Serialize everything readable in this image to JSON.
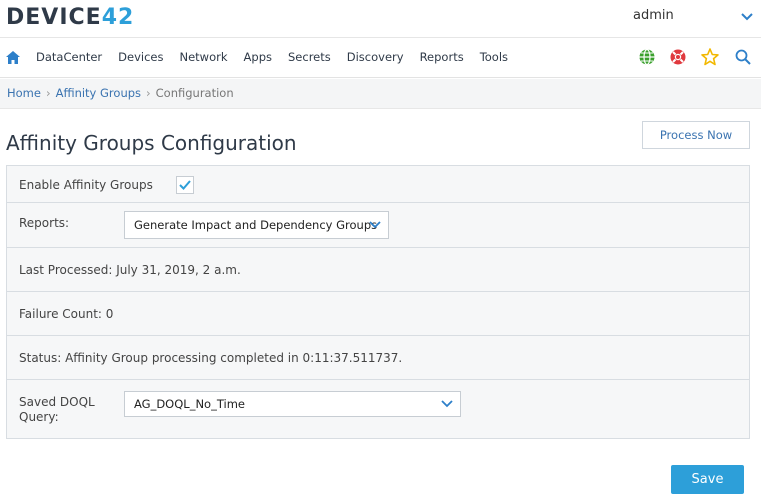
{
  "brand": {
    "logo_part1": "DEVIC",
    "logo_part2": "E",
    "logo_part3": "42"
  },
  "user": {
    "name": "admin"
  },
  "nav": {
    "items": [
      "DataCenter",
      "Devices",
      "Network",
      "Apps",
      "Secrets",
      "Discovery",
      "Reports",
      "Tools"
    ],
    "icons": [
      "home-icon",
      "globe-icon",
      "help-lifebuoy-icon",
      "star-icon",
      "search-icon"
    ]
  },
  "breadcrumb": {
    "home": "Home",
    "section": "Affinity Groups",
    "current": "Configuration",
    "separator": "›"
  },
  "page": {
    "title": "Affinity Groups Configuration",
    "process_button": "Process Now"
  },
  "form": {
    "enable_label": "Enable Affinity Groups",
    "enable_checked": true,
    "reports_label": "Reports:",
    "reports_value": "Generate Impact and Dependency Groups",
    "last_processed": "Last Processed: July 31, 2019, 2 a.m.",
    "failure_count": "Failure Count: 0",
    "status": "Status: Affinity Group processing completed in 0:11:37.511737.",
    "saved_doql_label_line1": "Saved DOQL",
    "saved_doql_label_line2": "Query:",
    "saved_doql_value": "AG_DOQL_No_Time"
  },
  "actions": {
    "save": "Save"
  },
  "colors": {
    "accent": "#2d9fd9",
    "link": "#3a73b0",
    "globe": "#3aa02c",
    "lifebuoy": "#e0393e",
    "star": "#f2b800"
  }
}
